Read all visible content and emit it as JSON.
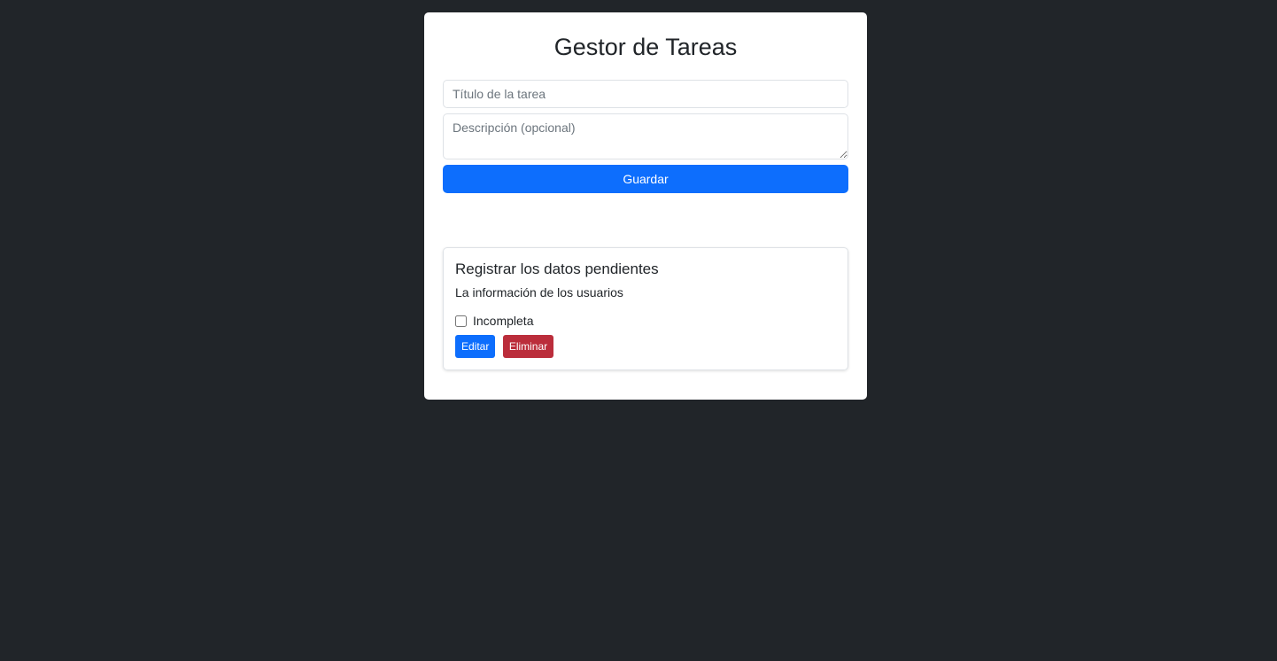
{
  "header": {
    "title": "Gestor de Tareas"
  },
  "form": {
    "title_placeholder": "Título de la tarea",
    "description_placeholder": "Descripción (opcional)",
    "save_label": "Guardar"
  },
  "tasks": [
    {
      "title": "Registrar los datos pendientes",
      "description": "La información de los usuarios",
      "status": "Incompleta",
      "completed": false,
      "edit_label": "Editar",
      "delete_label": "Eliminar"
    }
  ],
  "colors": {
    "background": "#212529",
    "primary": "#0d6efd",
    "danger": "#bb2d3b"
  }
}
